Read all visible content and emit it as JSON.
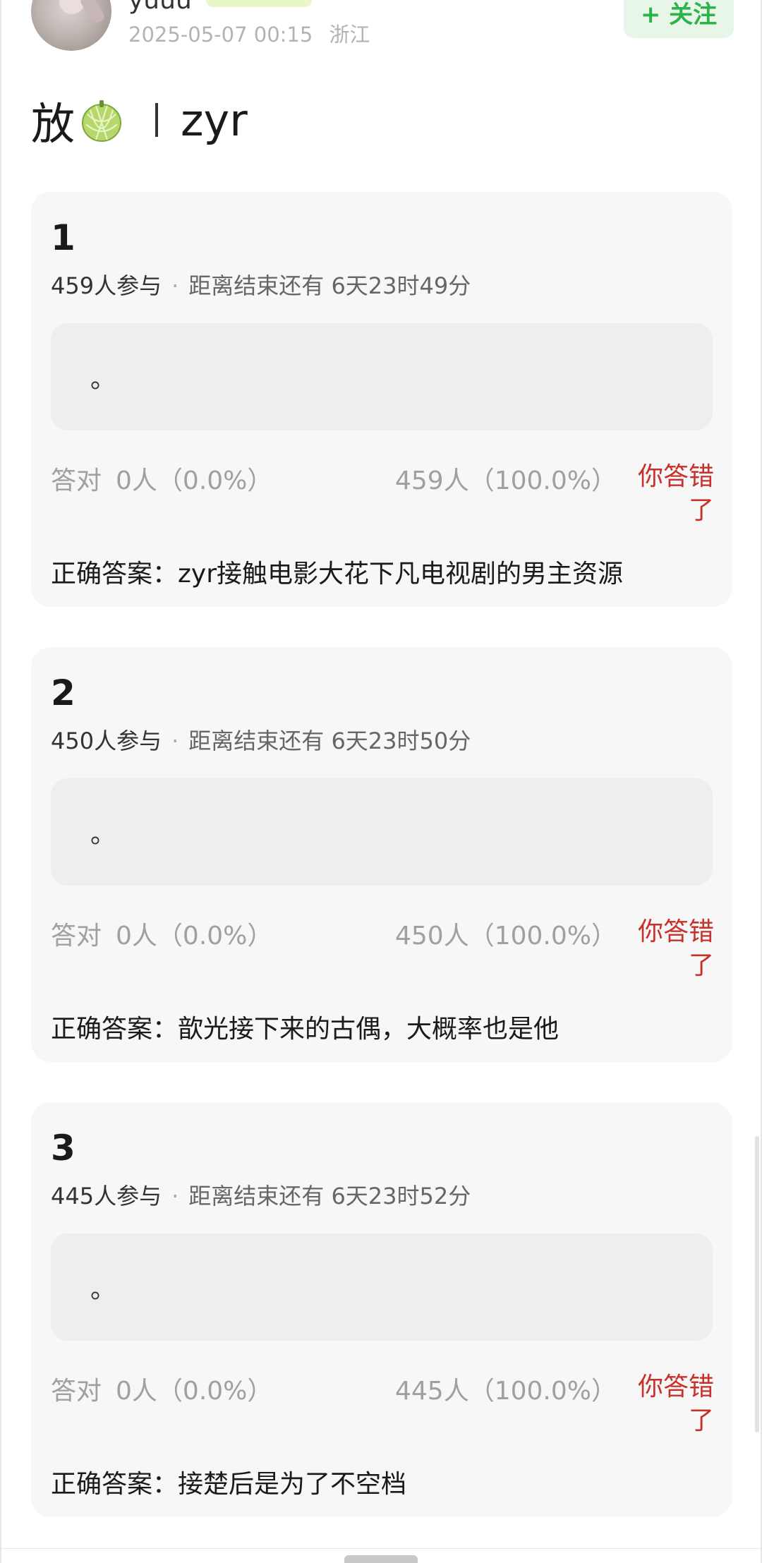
{
  "post": {
    "username": "yuuu",
    "timestamp": "2025-05-07 00:15",
    "location": "浙江",
    "follow_label": "+ 关注",
    "title_prefix": "放",
    "title_suffix": "zyr",
    "title_icon": "melon-icon"
  },
  "quizzes": [
    {
      "number": "1",
      "participants": "459人参与",
      "remaining": "距离结束还有 6天23时49分",
      "option_text": "。",
      "correct_label": "答对",
      "correct_count": "0人（0.0%）",
      "wrong_count": "459人（100.0%）",
      "verdict": "你答错了",
      "answer": "正确答案：zyr接触电影大花下凡电视剧的男主资源"
    },
    {
      "number": "2",
      "participants": "450人参与",
      "remaining": "距离结束还有 6天23时50分",
      "option_text": "。",
      "correct_label": "答对",
      "correct_count": "0人（0.0%）",
      "wrong_count": "450人（100.0%）",
      "verdict": "你答错了",
      "answer": "正确答案：歆光接下来的古偶，大概率也是他"
    },
    {
      "number": "3",
      "participants": "445人参与",
      "remaining": "距离结束还有 6天23时52分",
      "option_text": "。",
      "correct_label": "答对",
      "correct_count": "0人（0.0%）",
      "wrong_count": "445人（100.0%）",
      "verdict": "你答错了",
      "answer": "正确答案：接楚后是为了不空档"
    }
  ],
  "colors": {
    "accent_green": "#2db34a",
    "wrong_red": "#c7302b",
    "card_bg": "#f7f7f7",
    "option_bg": "#eeeeee"
  }
}
